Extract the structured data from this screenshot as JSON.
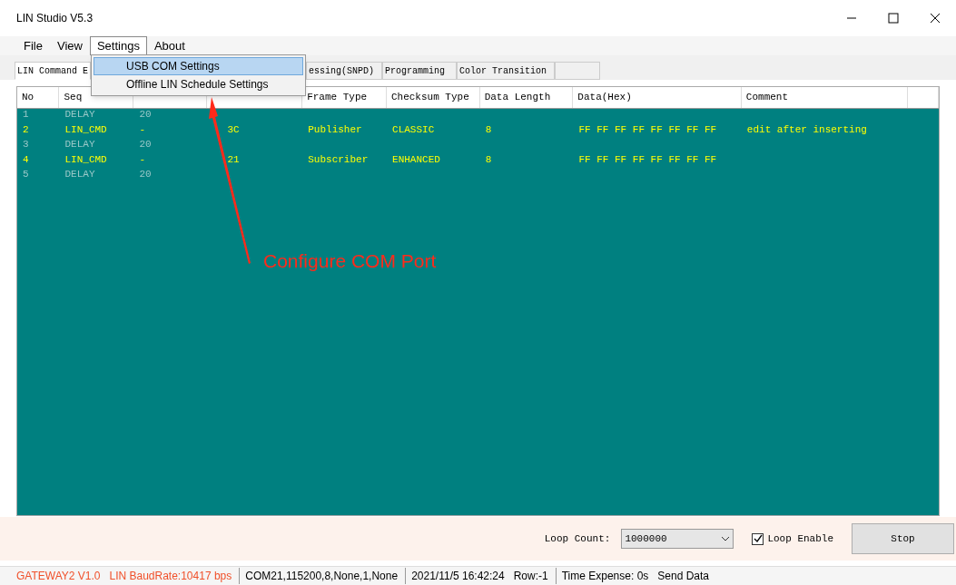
{
  "window": {
    "title": "LIN Studio V5.3"
  },
  "menu": [
    {
      "label": "File",
      "selected": false
    },
    {
      "label": "View",
      "selected": false
    },
    {
      "label": "Settings",
      "selected": true
    },
    {
      "label": "About",
      "selected": false
    }
  ],
  "dropdown": [
    {
      "label": "USB COM Settings",
      "selected": true
    },
    {
      "label": "Offline LIN Schedule Settings",
      "selected": false
    }
  ],
  "tabs": [
    {
      "label": "LIN Command E",
      "selected": true
    },
    {
      "label": "essing(SNPD)",
      "selected": false
    },
    {
      "label": "Programming",
      "selected": false
    },
    {
      "label": "Color Transition",
      "selected": false
    }
  ],
  "table": {
    "columns": [
      "No",
      "Seq",
      null,
      null,
      "Frame Type",
      "Checksum Type",
      "Data Length",
      "Data(Hex)",
      "Comment",
      null
    ],
    "rows": [
      {
        "kind": "delay",
        "cells": [
          "1",
          "DELAY",
          "20",
          "",
          "",
          "",
          "",
          "",
          "",
          ""
        ]
      },
      {
        "kind": "command",
        "cells": [
          "2",
          "LIN_CMD",
          "-",
          "3C",
          "Publisher",
          "CLASSIC",
          "8",
          "FF FF FF FF FF FF FF FF",
          "edit after inserting",
          ""
        ]
      },
      {
        "kind": "delay",
        "cells": [
          "3",
          "DELAY",
          "20",
          "",
          "",
          "",
          "",
          "",
          "",
          ""
        ]
      },
      {
        "kind": "command",
        "cells": [
          "4",
          "LIN_CMD",
          "-",
          "21",
          "Subscriber",
          "ENHANCED",
          "8",
          "FF FF FF FF FF FF FF FF",
          "",
          ""
        ]
      },
      {
        "kind": "delay",
        "cells": [
          "5",
          "DELAY",
          "20",
          "",
          "",
          "",
          "",
          "",
          "",
          ""
        ]
      }
    ]
  },
  "annotation": "Configure COM Port",
  "controls": {
    "loop_count_label": "Loop Count:",
    "loop_count": "1000000",
    "loop_enable": {
      "label": "Loop Enable",
      "checked": true
    },
    "stop_button": "Stop"
  },
  "status_bar": [
    {
      "kind": "alert",
      "text": "GATEWAY2  V1.0"
    },
    {
      "kind": "alert",
      "text": "LIN BaudRate:10417 bps"
    },
    {
      "kind": "plain",
      "text": "COM21,115200,8,None,1,None"
    },
    {
      "kind": "plain",
      "text": "2021/11/5 16:42:24"
    },
    {
      "kind": "plain",
      "text": "Row:-1"
    },
    {
      "kind": "plain",
      "text": "Time Expense: 0s"
    },
    {
      "kind": "plain",
      "text": "Send Data"
    }
  ]
}
